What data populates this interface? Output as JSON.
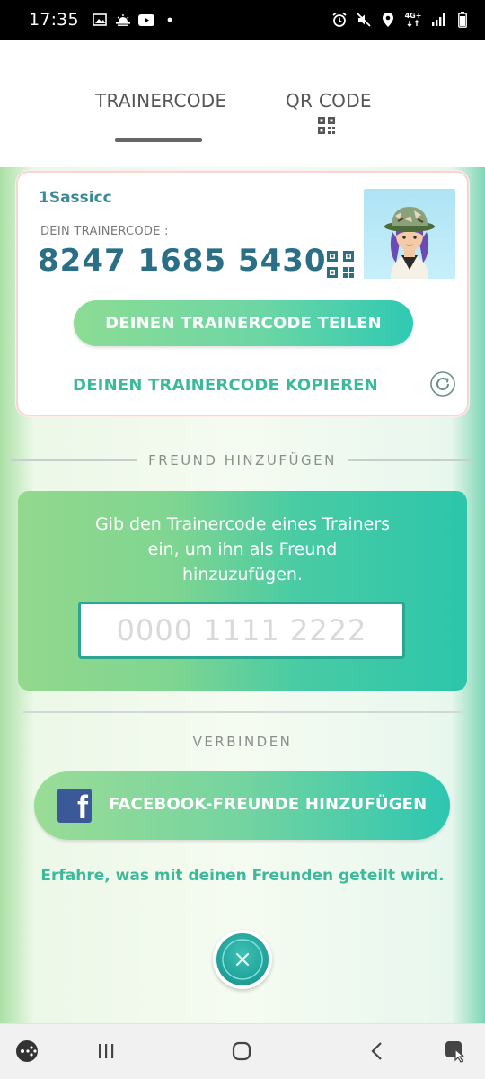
{
  "status_bar": {
    "time": "17:35",
    "network": "4G+",
    "left_icons": [
      "image-icon",
      "weather-icon",
      "youtube-icon",
      "dot-icon"
    ],
    "right_icons": [
      "alarm-icon",
      "mute-icon",
      "location-icon",
      "network-4g-icon",
      "signal-icon",
      "battery-icon"
    ]
  },
  "tabs": [
    {
      "label": "TRAINERCODE",
      "active": true
    },
    {
      "label": "QR CODE",
      "active": false,
      "icon": "qr-code-icon"
    }
  ],
  "trainer_card": {
    "name": "1Sassicc",
    "code_label": "DEIN TRAINERCODE :",
    "code": "8247 1685 5430",
    "share_button": "DEINEN TRAINERCODE TEILEN",
    "copy_link": "DEINEN TRAINERCODE KOPIEREN"
  },
  "add_friend": {
    "section_label": "FREUND HINZUFÜGEN",
    "instruction": "Gib den Trainercode eines Trainers ein, um ihn als Freund hinzuzufügen.",
    "input_placeholder": "0000 1111 2222",
    "input_value": ""
  },
  "connect": {
    "section_label": "VERBINDEN",
    "facebook_button": "FACEBOOK-FREUNDE HINZUFÜGEN",
    "learn_link": "Erfahre, was mit deinen Freunden geteilt wird."
  },
  "colors": {
    "accent_teal": "#3bb99a",
    "code_blue": "#2b6f86",
    "facebook_blue": "#3b5998"
  },
  "nav_bar": {
    "items": [
      "game-launcher-icon",
      "recent-apps-icon",
      "home-icon",
      "back-icon",
      "screenshot-assist-icon"
    ]
  }
}
